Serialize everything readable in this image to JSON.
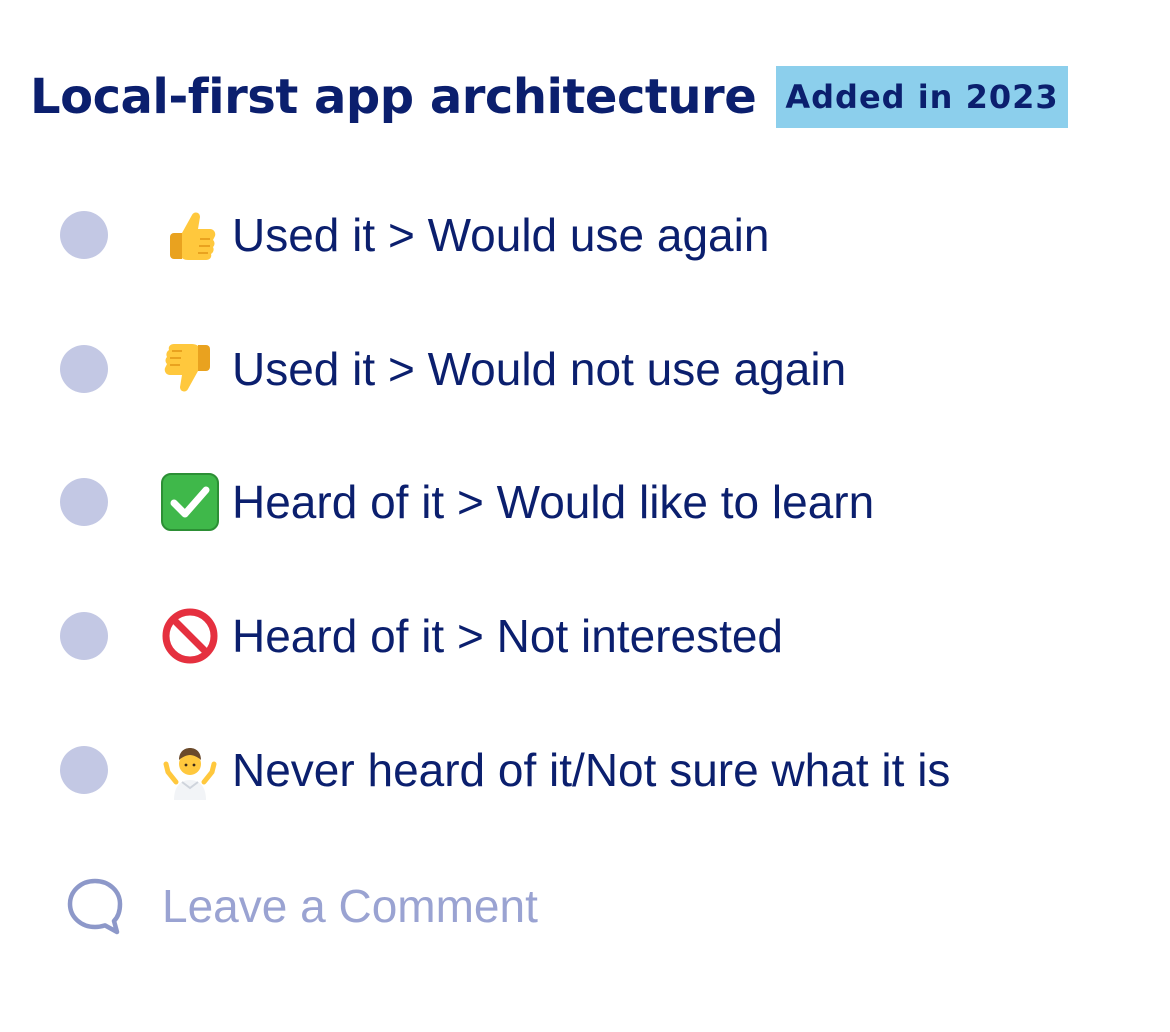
{
  "question": {
    "title": "Local-first app architecture",
    "badge": "Added in 2023"
  },
  "options": [
    {
      "icon": "thumbs-up-icon",
      "label": "Used it > Would use again"
    },
    {
      "icon": "thumbs-down-icon",
      "label": "Used it > Would not use again"
    },
    {
      "icon": "check-mark-icon",
      "label": "Heard of it > Would like to learn"
    },
    {
      "icon": "prohibited-icon",
      "label": "Heard of it > Not interested"
    },
    {
      "icon": "shrug-icon",
      "label": "Never heard of it/Not sure what it is"
    }
  ],
  "comment": {
    "icon": "comment-bubble-icon",
    "label": "Leave a Comment"
  },
  "colors": {
    "text": "#0b1f6e",
    "badge_bg": "#8ccfec",
    "radio": "#c3c8e4",
    "comment": "#9aa3d2"
  }
}
